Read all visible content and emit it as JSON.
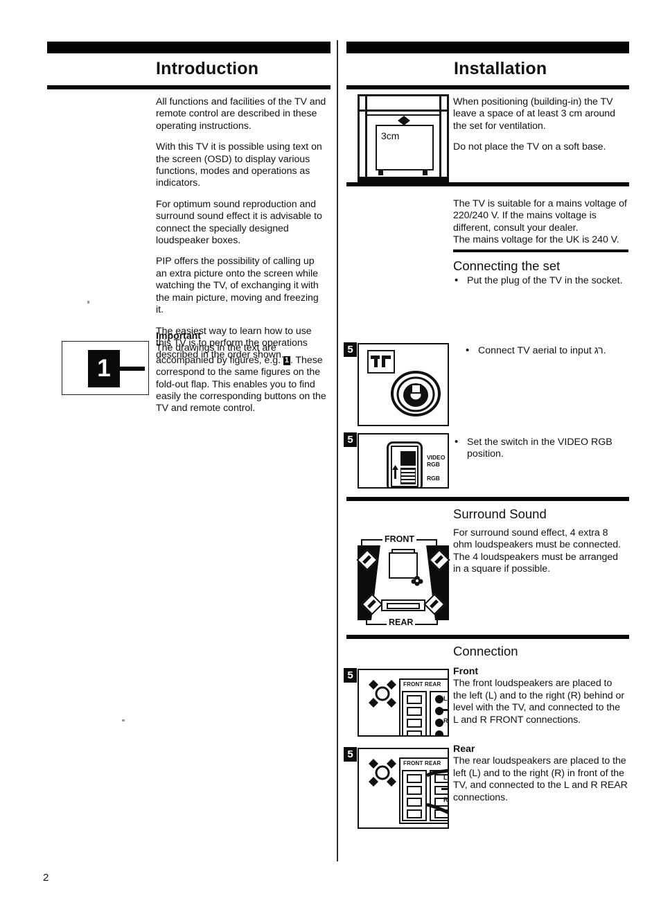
{
  "document": {
    "page_number": "2"
  },
  "left_column": {
    "title": "Introduction",
    "paragraphs": [
      "All functions and facilities of the TV and remote control are described in these operating instructions.",
      "With this TV it is possible using text on the screen (OSD) to display various functions, modes and operations as indicators.",
      "For optimum sound reproduction and surround sound effect it is advisable to connect the specially designed loudspeaker boxes.",
      "PIP offers the possibility of calling up an extra picture onto the screen while watching the TV, of exchanging it with the main picture, moving and freezing it.",
      "The easiest way to learn how to use this TV is to perform the operations described in the order shown."
    ],
    "important": {
      "heading": "Important",
      "text_before": "The drawings in the text are accompanied by figures, e.g. ",
      "inline_figure": "1",
      "text_after": ". These correspond to the same figures on the fold-out flap. This enables you to find easily the corresponding buttons on the TV and remote control.",
      "figure_number": "1"
    }
  },
  "right_column": {
    "title": "Installation",
    "positioning": {
      "paragraphs": [
        "When positioning (building-in) the TV leave a space of at least 3 cm around the set for ventilation.",
        "Do not place the TV on a soft base."
      ],
      "diagram_label": "3cm"
    },
    "mains": {
      "paragraph": "The TV is suitable for a mains voltage of 220/240 V. If the mains voltage is different, consult your dealer.\nThe mains voltage for the UK is 240 V."
    },
    "connecting_the_set": {
      "heading": "Connecting the set",
      "bullets": [
        "Put the plug of the TV in the socket."
      ],
      "figures": [
        {
          "badge": "5",
          "bullet": "Connect TV aerial to input רג."
        },
        {
          "badge": "5",
          "bullet": "Set the switch in the VIDEO RGB position.",
          "switch_labels": [
            "VIDEO",
            "RGB",
            "RGB"
          ]
        }
      ]
    },
    "surround_sound": {
      "heading": "Surround Sound",
      "paragraph": "For surround sound effect, 4 extra 8 ohm loudspeakers must be connected. The 4 loudspeakers must be arranged in a square if possible.",
      "diagram_labels": {
        "front": "FRONT",
        "rear": "REAR"
      }
    },
    "connection": {
      "heading": "Connection",
      "items": [
        {
          "badge": "5",
          "subheading": "Front",
          "text": "The front loudspeakers are placed to the left (L) and to the right (R) behind or level with the TV, and connected to the L and R FRONT connections.",
          "terminal_title": "FRONT REAR",
          "terminal_marks": [
            "L",
            "R"
          ]
        },
        {
          "badge": "5",
          "subheading": "Rear",
          "text": "The rear loudspeakers are placed to the left (L) and to the right (R) in front of the TV, and connected to the L and R REAR connections.",
          "terminal_title": "FRONT REAR",
          "terminal_marks": [
            "L",
            "R"
          ]
        }
      ]
    }
  }
}
